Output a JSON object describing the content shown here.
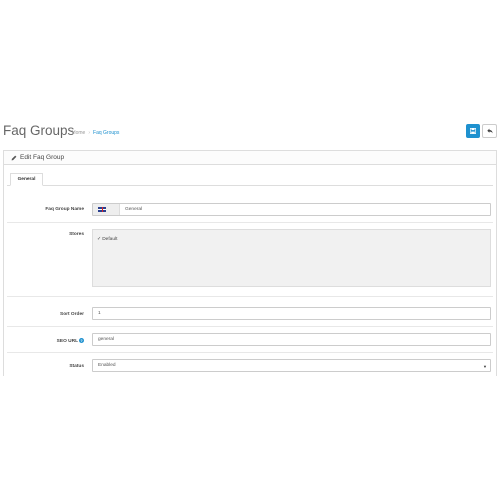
{
  "header": {
    "title": "Faq Groups",
    "breadcrumb": [
      {
        "label": "Home"
      },
      {
        "label": "Faq Groups"
      }
    ],
    "save_icon": "save-icon",
    "back_icon": "reply-icon",
    "accent": "#1e91cf"
  },
  "panel": {
    "heading": "Edit Faq Group",
    "heading_icon": "pencil-icon"
  },
  "tabs": [
    {
      "label": "General",
      "active": true
    }
  ],
  "form": {
    "group_name": {
      "label": "Faq Group Name",
      "value": "General",
      "flag_icon": "uk-flag-icon"
    },
    "stores": {
      "label": "Stores",
      "items": [
        {
          "label": "Default",
          "checked": true
        }
      ]
    },
    "sort_order": {
      "label": "Sort Order",
      "value": "1"
    },
    "seo_url": {
      "label": "SEO URL",
      "value": "general",
      "help_icon": "question-circle-icon"
    },
    "status": {
      "label": "Status",
      "value": "Enabled",
      "options": [
        "Enabled"
      ]
    }
  }
}
